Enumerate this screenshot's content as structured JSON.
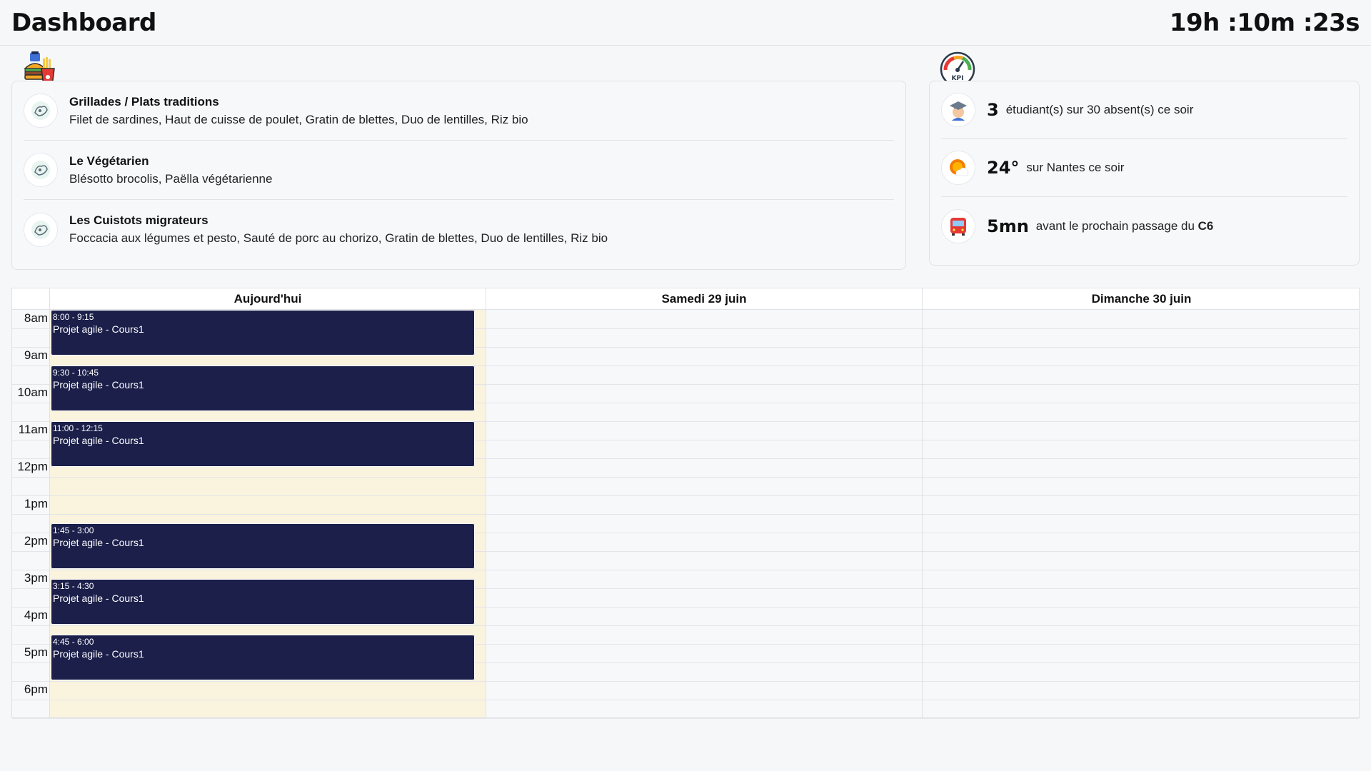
{
  "header": {
    "title": "Dashboard",
    "clock": "19h :10m :23s"
  },
  "menu": {
    "icon": "fast-food-icon",
    "items": [
      {
        "name": "Grillades / Plats traditions",
        "dishes": "Filet de sardines, Haut de cuisse de poulet, Gratin de blettes, Duo de lentilles, Riz bio"
      },
      {
        "name": "Le Végétarien",
        "dishes": "Blésotto brocolis, Paëlla végétarienne"
      },
      {
        "name": "Les Cuistots migrateurs",
        "dishes": "Foccacia aux légumes et pesto, Sauté de porc au chorizo, Gratin de blettes, Duo de lentilles, Riz bio"
      }
    ]
  },
  "kpi": {
    "icon": "kpi-gauge-icon",
    "badge": "KPI",
    "items": [
      {
        "icon": "student-icon",
        "value": "3",
        "text": "étudiant(s) sur 30 absent(s) ce soir",
        "strong": ""
      },
      {
        "icon": "weather-icon",
        "value": "24°",
        "text": "sur Nantes ce soir",
        "strong": ""
      },
      {
        "icon": "bus-icon",
        "value": "5mn",
        "text": "avant le prochain passage du ",
        "strong": "C6"
      }
    ]
  },
  "calendar": {
    "columns": [
      "Aujourd'hui",
      "Samedi 29 juin",
      "Dimanche 30 juin"
    ],
    "hours": [
      "8am",
      "9am",
      "10am",
      "11am",
      "12pm",
      "1pm",
      "2pm",
      "3pm",
      "4pm",
      "5pm",
      "6pm"
    ],
    "events": [
      {
        "time": "8:00 - 9:15",
        "title": "Projet agile - Cours1"
      },
      {
        "time": "9:30 - 10:45",
        "title": "Projet agile - Cours1"
      },
      {
        "time": "11:00 - 12:15",
        "title": "Projet agile - Cours1"
      },
      {
        "time": "1:45 - 3:00",
        "title": "Projet agile - Cours1"
      },
      {
        "time": "3:15 - 4:30",
        "title": "Projet agile - Cours1"
      },
      {
        "time": "4:45 - 6:00",
        "title": "Projet agile - Cours1"
      }
    ]
  },
  "colors": {
    "event": "#1b1f4a",
    "today": "#faf3de",
    "background": "#f6f7f9"
  }
}
